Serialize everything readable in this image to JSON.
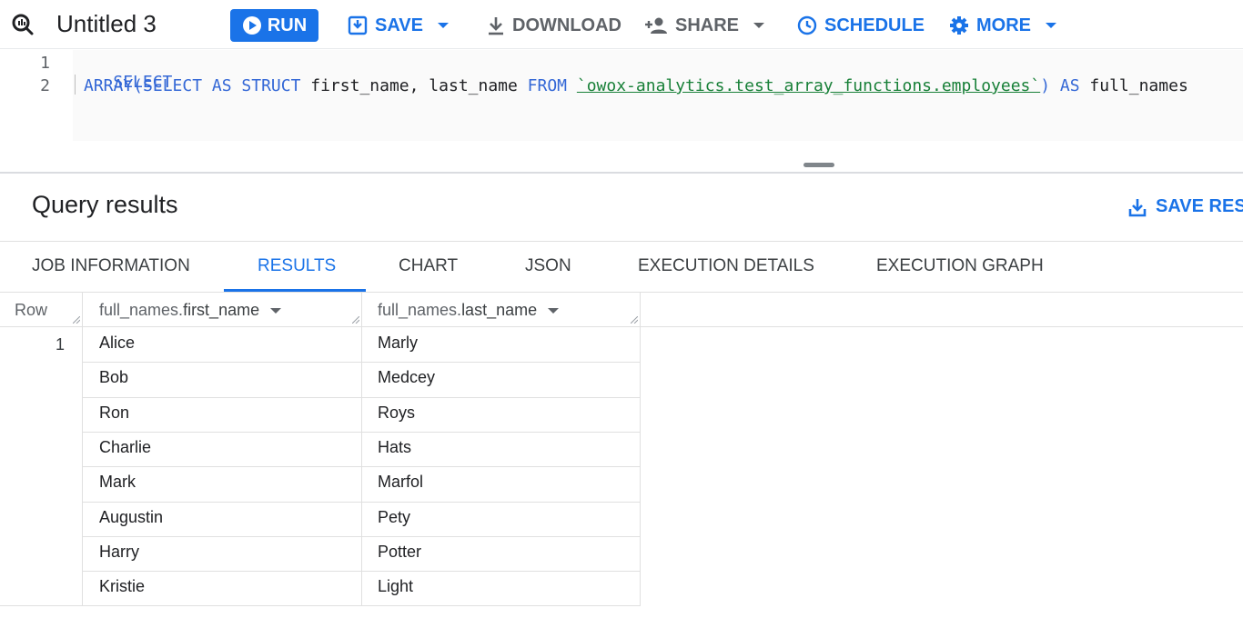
{
  "toolbar": {
    "title": "Untitled 3",
    "run_label": "RUN",
    "save_label": "SAVE",
    "download_label": "DOWNLOAD",
    "share_label": "SHARE",
    "schedule_label": "SCHEDULE",
    "more_label": "MORE"
  },
  "editor": {
    "line_numbers": [
      "1",
      "2"
    ],
    "line1": {
      "kw": "SELECT"
    },
    "line2": {
      "kw1": "ARRAY(SELECT AS STRUCT",
      "plain1": " first_name, last_name ",
      "kw2": "FROM",
      "table": "`owox-analytics.test_array_functions.employees`",
      "kw3": ") AS",
      "plain2": " full_names"
    }
  },
  "results": {
    "title": "Query results",
    "save_results_label": "SAVE RESU"
  },
  "tabs": [
    {
      "label": "JOB INFORMATION"
    },
    {
      "label": "RESULTS"
    },
    {
      "label": "CHART"
    },
    {
      "label": "JSON"
    },
    {
      "label": "EXECUTION DETAILS"
    },
    {
      "label": "EXECUTION GRAPH"
    }
  ],
  "grid": {
    "row_header": "Row",
    "columns": [
      {
        "prefix": "full_names.",
        "field": "first_name"
      },
      {
        "prefix": "full_names.",
        "field": "last_name"
      }
    ],
    "row_number": "1",
    "rows": [
      [
        "Alice",
        "Marly"
      ],
      [
        "Bob",
        "Medcey"
      ],
      [
        "Ron",
        "Roys"
      ],
      [
        "Charlie",
        "Hats"
      ],
      [
        "Mark",
        "Marfol"
      ],
      [
        "Augustin",
        "Pety"
      ],
      [
        "Harry",
        "Potter"
      ],
      [
        "Kristie",
        "Light"
      ]
    ]
  },
  "colors": {
    "accent": "#1a73e8",
    "keyword": "#3367d6",
    "string": "#188038"
  }
}
